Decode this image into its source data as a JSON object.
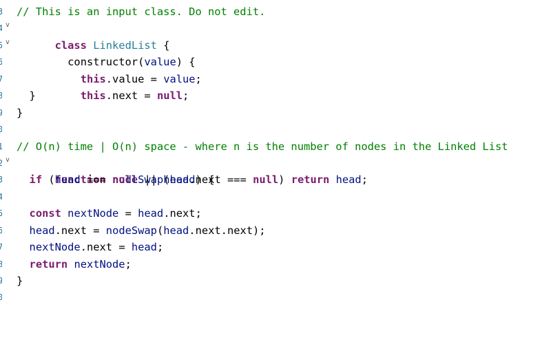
{
  "editor": {
    "gutter_numbers": [
      "3",
      "4",
      "5",
      "6",
      "7",
      "8",
      "9",
      "0",
      "1",
      "2",
      "3",
      "4",
      "5",
      "6",
      "7",
      "8",
      "9",
      "0"
    ],
    "lines": [
      {
        "text": "// This is an input class. Do not edit."
      },
      {
        "kw": "class",
        "name": "LinkedList",
        "rest": " {"
      },
      {
        "indent": "  ",
        "fn": "constructor",
        "p1": "(",
        "arg": "value",
        "p2": ") {"
      },
      {
        "indent": "    ",
        "this": "this",
        "dot": ".",
        "prop": "value",
        "eq": " = ",
        "val": "value",
        "end": ";"
      },
      {
        "indent": "    ",
        "this": "this",
        "dot": ".",
        "prop": "next",
        "eq": " = ",
        "val": "null",
        "end": ";"
      },
      {
        "text": "  }"
      },
      {
        "text": "}"
      },
      {
        "text": ""
      },
      {
        "text": "// O(n) time | O(n) space - where n is the number of nodes in the Linked List"
      },
      {
        "kw": "function",
        "name": "nodeSwap",
        "p1": "(",
        "arg": "head",
        "p2": ") {"
      },
      {
        "text": ""
      },
      {
        "text": ""
      },
      {
        "text": "  const nextNode = head.next;"
      },
      {
        "text": "  head.next = nodeSwap(head.next.next);"
      },
      {
        "text": "  nextNode.next = head;"
      },
      {
        "text": "  return nextNode;"
      },
      {
        "text": "}"
      }
    ],
    "if_line": {
      "kw": "if",
      "a": "head",
      "op1": "===",
      "n1": "null",
      "or": "||",
      "b": "head",
      "bprop": "next",
      "op2": "===",
      "n2": "null",
      "ret": "return",
      "c": "head"
    },
    "const_kw": "const",
    "nextNode": "nextNode",
    "head": "head",
    "next": "next",
    "nodeSwap": "nodeSwap",
    "return_kw": "return"
  },
  "colors": {
    "comment": "#008000",
    "keyword": "#0000ff",
    "identifier": "#001080",
    "function": "#795e26",
    "gutter": "#237893"
  }
}
